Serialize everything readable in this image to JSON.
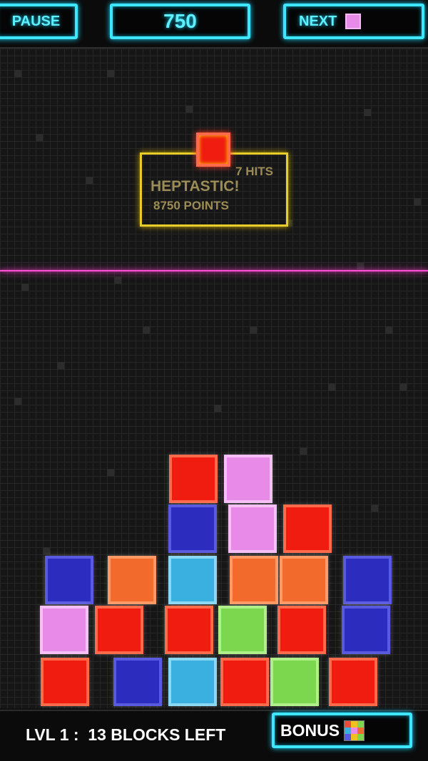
{
  "topbar": {
    "pause_label": "PAUSE",
    "score": "750",
    "next_label": "NEXT",
    "next_color": "#e88ae8"
  },
  "combo": {
    "hits": "7  HITS",
    "word": "HEPTASTIC!",
    "points": "8750   POINTS"
  },
  "falling_block_color": "red",
  "board": {
    "palette": {
      "red": [
        "#f01c10",
        "#ff6a4a"
      ],
      "pink": [
        "#e88ae8",
        "#f6c0f6"
      ],
      "blue": [
        "#2c2cbe",
        "#5a5ae0"
      ],
      "cyan": [
        "#3ab0e0",
        "#8ad8f4"
      ],
      "orange": [
        "#f26a2c",
        "#ff9a64"
      ],
      "green": [
        "#7cd64e",
        "#b0f08a"
      ]
    },
    "columns": 8,
    "rows": 5,
    "cells": [
      [
        null,
        null,
        "red",
        "pink",
        null,
        null,
        null,
        null
      ],
      [
        null,
        null,
        "blue",
        "pink",
        "red",
        null,
        null,
        null
      ],
      [
        "blue",
        "orange",
        "cyan",
        "orange",
        "orange",
        "blue",
        null,
        null
      ],
      [
        "pink",
        "red",
        "red",
        "green",
        "red",
        "blue",
        null,
        null
      ],
      [
        "red",
        "blue",
        "cyan",
        "red",
        "green",
        "red",
        null,
        null
      ]
    ]
  },
  "footer": {
    "level_text": "LVL 1 :  13 BLOCKS LEFT",
    "bonus_label": "BONUS",
    "bonus_icon_colors": [
      "#e84c3c",
      "#f0c020",
      "#7cd64e",
      "#3ab0e0",
      "#e88ae8",
      "#f26a2c",
      "#5a5ae0",
      "#f0c020",
      "#7cd64e"
    ]
  }
}
